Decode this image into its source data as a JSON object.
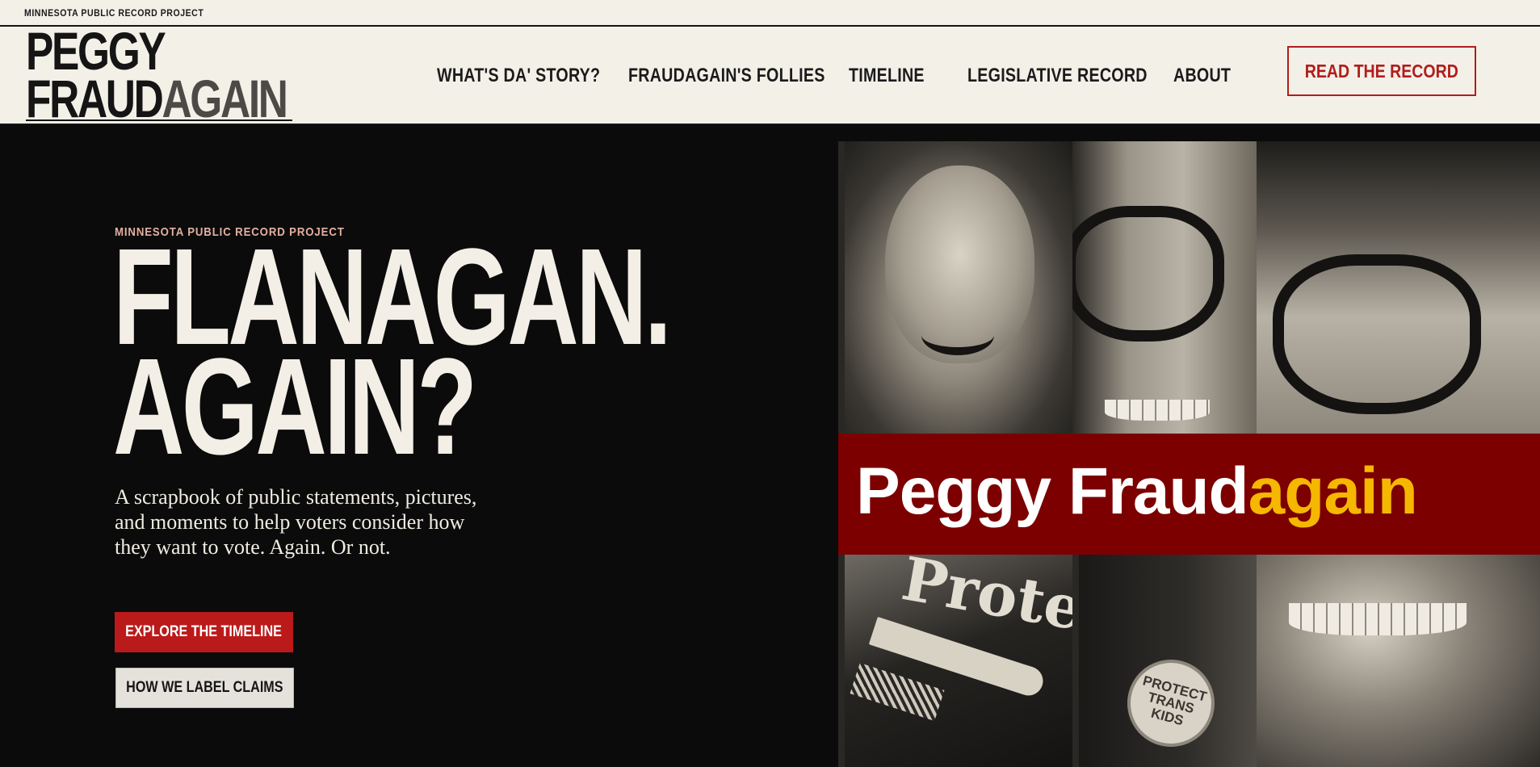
{
  "header": {
    "top_label": "MINNESOTA PUBLIC RECORD PROJECT",
    "logo_line1": "PEGGY",
    "logo_line2_a": "FRAUD",
    "logo_line2_b": "AGAIN",
    "nav": [
      {
        "label": "WHAT'S DA' STORY?"
      },
      {
        "label": "FRAUDAGAIN'S FOLLIES"
      },
      {
        "label": "TIMELINE"
      },
      {
        "label": "LEGISLATIVE RECORD"
      },
      {
        "label": "ABOUT"
      }
    ],
    "cta_label": "READ THE RECORD"
  },
  "hero": {
    "kicker": "MINNESOTA PUBLIC RECORD PROJECT",
    "headline_line1": "FLANAGAN.",
    "headline_line2": "AGAIN?",
    "description": "A scrapbook of public statements, pictures, and moments to help voters consider how they want to vote. Again. Or not.",
    "primary_button": "EXPLORE THE TIMELINE",
    "secondary_button": "HOW WE LABEL CLAIMS"
  },
  "collage": {
    "banner_white": "Peggy Fraud",
    "banner_yellow": "again",
    "shirt_text": "Protec",
    "badge_text": "PROTECT TRANS KIDS"
  },
  "colors": {
    "accent_red": "#bb1a1a",
    "banner_red": "#7c0000",
    "banner_yellow": "#f5b700",
    "cream": "#f3f0e8",
    "dark": "#0b0b0b"
  }
}
